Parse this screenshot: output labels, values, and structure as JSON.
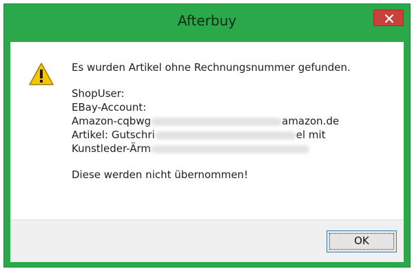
{
  "window": {
    "title": "Afterbuy",
    "close_icon": "close-icon",
    "colors": {
      "title_bar": "#2ba84a",
      "close_button": "#c9413a"
    }
  },
  "dialog": {
    "icon": "warning-icon",
    "heading": "Es wurden Artikel ohne Rechnungsnummer gefunden.",
    "fields": {
      "shop_user": "ShopUser:",
      "ebay_account": "EBay-Account:",
      "amazon_prefix": "Amazon-cqbwg",
      "amazon_suffix": "amazon.de",
      "artikel_prefix": "Artikel: Gutschri",
      "artikel_suffix": "el mit",
      "kunstleder_prefix": "Kunstleder-Ärm"
    },
    "footer_text": "Diese werden nicht übernommen!",
    "ok_label": "OK"
  }
}
